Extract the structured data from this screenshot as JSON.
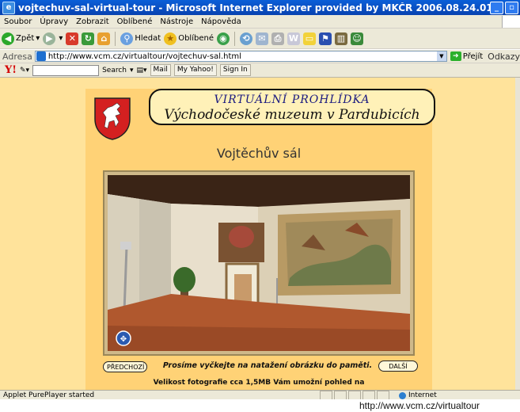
{
  "window": {
    "title": "vojtechuv-sal-virtual-tour - Microsoft Internet Explorer provided by MKČR 2006.08.24.01"
  },
  "menu": [
    "Soubor",
    "Úpravy",
    "Zobrazit",
    "Oblíbené",
    "Nástroje",
    "Nápověda"
  ],
  "toolbar": {
    "back": "Zpět",
    "search": "Hledat",
    "favorites": "Oblíbené"
  },
  "address": {
    "label": "Adresa",
    "url": "http://www.vcm.cz/virtualtour/vojtechuv-sal.html",
    "go": "Přejít",
    "links": "Odkazy"
  },
  "yahoo_bar": {
    "search": "Search",
    "mail": "Mail",
    "my_yahoo": "My Yahoo!",
    "sign_in": "Sign In"
  },
  "page": {
    "banner_line1": "VIRTUÁLNÍ PROHLÍDKA",
    "banner_line2": "Východočeské muzeum v Pardubicích",
    "room_title": "Vojtěchův sál",
    "prev_button": "PŘEDCHOZÍ",
    "next_button": "DALŠÍ",
    "wait_message": "Prosíme vyčkejte na natažení obrázku do paměti.",
    "photo_note": "Velikost fotografie cca 1,5MB Vám umožní pohled na"
  },
  "status": {
    "text": "Applet PurePlayer started",
    "zone": "Internet"
  },
  "footer_url": "http://www.vcm.cz/virtualtour"
}
